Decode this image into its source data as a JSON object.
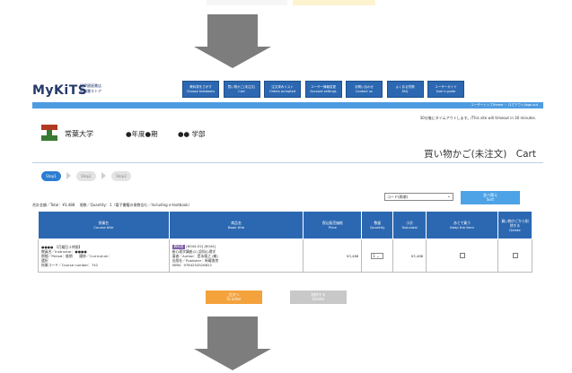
{
  "header": {
    "logo": "MyKiTS",
    "logo_sub_1": "紀伊國屋書店",
    "logo_sub_2": "教科書ストア"
  },
  "nav": [
    {
      "ja": "教科書をさがす",
      "en": "Choose textbooks"
    },
    {
      "ja": "買い物かご(未注文)",
      "en": "Cart"
    },
    {
      "ja": "注文済みリスト",
      "en": "Orders accepted"
    },
    {
      "ja": "ユーザー情報変更",
      "en": "Account settings"
    },
    {
      "ja": "お問い合わせ",
      "en": "Contact us"
    },
    {
      "ja": "よくある質問",
      "en": "FAQ"
    },
    {
      "ja": "ユーザーガイド",
      "en": "User's guide"
    }
  ],
  "breadcrumb": "ユーザートップ/Home ・ ログアウト/logo out",
  "timeout_notice": "30分後にタイムアウトします。/This site will timeout in 30 minutes.",
  "university": {
    "name": "常葉大学",
    "term": "●年度●期",
    "faculty": "●● 学部"
  },
  "page_title": "買い物かご(未注文)　Cart",
  "steps": [
    "Step1",
    "Step2",
    "Step3"
  ],
  "sort": {
    "select_value": "コード(昇順)",
    "button_ja": "並べ替え",
    "button_en": "Sort"
  },
  "totals": "合計金額／Total：¥3,488　 冊数／Quantity：1（電子書籍の冊数含む／Including e-textbook）",
  "table": {
    "headers": [
      {
        "ja": "授業名",
        "en": "Course title"
      },
      {
        "ja": "商品名",
        "en": "Book title"
      },
      {
        "ja": "税込販売価格",
        "en": "Price"
      },
      {
        "ja": "数量",
        "en": "Quantity"
      },
      {
        "ja": "小計",
        "en": "Sub-total"
      },
      {
        "ja": "あとで買う",
        "en": "Keep the item"
      },
      {
        "ja": "買い物かごから削除する",
        "en": "Delete"
      }
    ],
    "row": {
      "course_line1": "●●●●　【月曜日２時限】",
      "course_line2": "教員名／Instructor：●●●●",
      "course_line3": "期間／Period：後期　　履修／Curriculum：",
      "course_line4": "選択",
      "course_line5": "授業コード／Course number：742",
      "badge": "教科書",
      "book_code": "[6044-02] [6044]",
      "book_line1": "新心理学講座(2) 認知心理学",
      "book_line2": "著者／Author：是永隆之 (編)",
      "book_line3": "出版社／Publisher：新曜書房",
      "book_line4": "ISBN：9784254526622",
      "price": "¥3,488",
      "quantity": "1",
      "subtotal": "¥3,488"
    }
  },
  "order_button": {
    "ja": "注文へ",
    "en": "To order"
  },
  "delete_button": {
    "ja": "削除する",
    "en": "Delete"
  }
}
